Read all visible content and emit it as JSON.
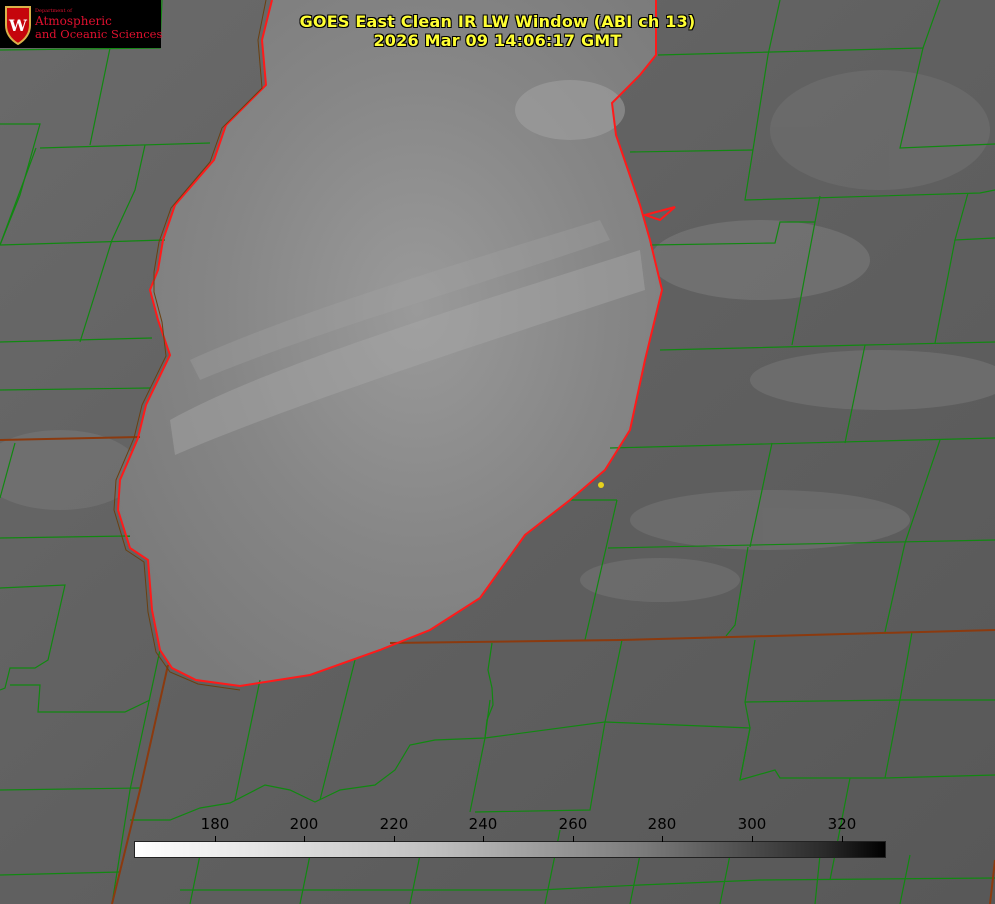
{
  "title": {
    "line1": "GOES East Clean IR LW Window (ABI ch 13)",
    "line2": "2026 Mar 09 14:06:17 GMT"
  },
  "logo": {
    "dept": "Department of",
    "line1": "Atmospheric",
    "line2": "and Oceanic Sciences",
    "crest_letter": "W",
    "crest_color": "#c5050c"
  },
  "colorbar": {
    "unit_values": [
      "180",
      "200",
      "220",
      "240",
      "260",
      "280",
      "300",
      "320"
    ],
    "min_label": "",
    "max_label": ""
  },
  "colors": {
    "county_lines": "#118811",
    "state_lines": "#8b3a0f",
    "coastline": "#ff1a1a",
    "title_text": "#ffff33",
    "station_marker": "#e8d21c"
  }
}
